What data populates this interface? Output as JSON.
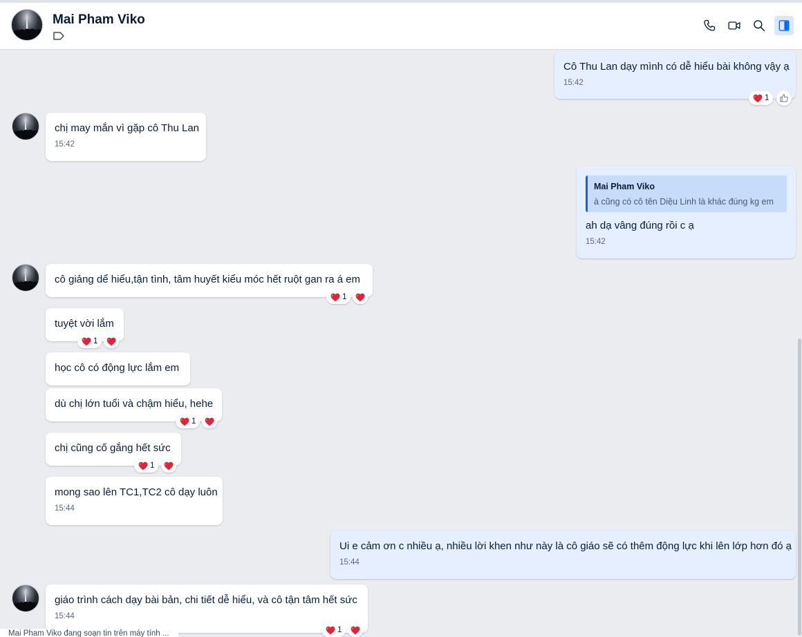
{
  "header": {
    "contact_name": "Mai Pham Viko",
    "icons": [
      "phone-icon",
      "video-call-icon",
      "search-icon",
      "toggle-panel-icon"
    ]
  },
  "colors": {
    "background": "#ebecf0",
    "my_bubble": "#e5efff",
    "their_bubble": "#ffffff",
    "accent": "#1f5fd0",
    "heart": "#e0243a"
  },
  "messages": {
    "m1": {
      "text": "Cô Thu Lan dạy mình có dễ hiểu bài không vậy ạ",
      "time": "15:42",
      "reaction_count": "1"
    },
    "m2": {
      "text": "chị may mắn vì gặp cô Thu Lan",
      "time": "15:42"
    },
    "m3": {
      "quote_name": "Mai Pham Viko",
      "quote_text": "à cũng có cô tên Diệu Linh là khác đúng kg em",
      "text": "ah dạ vâng đúng rồi c ạ",
      "time": "15:42"
    },
    "m4": {
      "text": "cô giảng dể hiểu,tận tình, tâm huyết kiểu móc hết ruột gan ra á em",
      "reaction_count": "1"
    },
    "m5": {
      "text": "tuyệt vời lắm",
      "reaction_count": "1"
    },
    "m6": {
      "text": "học cô có động lực lắm em"
    },
    "m7": {
      "text": "dù chị lớn tuổi và chậm hiểu, hehe",
      "reaction_count": "1"
    },
    "m8": {
      "text": "chị cũng cố gắng hết sức",
      "reaction_count": "1"
    },
    "m9": {
      "text": "mong sao lên TC1,TC2 cô dạy luôn",
      "time": "15:44"
    },
    "m10": {
      "text": "Ui e cảm ơn c nhiều ạ, nhiều lời khen như này là cô giáo sẽ có thêm động lực khi lên lớp hơn đó ạ",
      "time": "15:44"
    },
    "m11": {
      "text": "giáo trình cách dạy bài bản, chi tiết dễ hiểu, và cô tận tâm hết sức",
      "time": "15:44",
      "reaction_count": "1"
    }
  },
  "typing_indicator": "Mai Pham Viko đang soạn tin trên máy tính ..."
}
